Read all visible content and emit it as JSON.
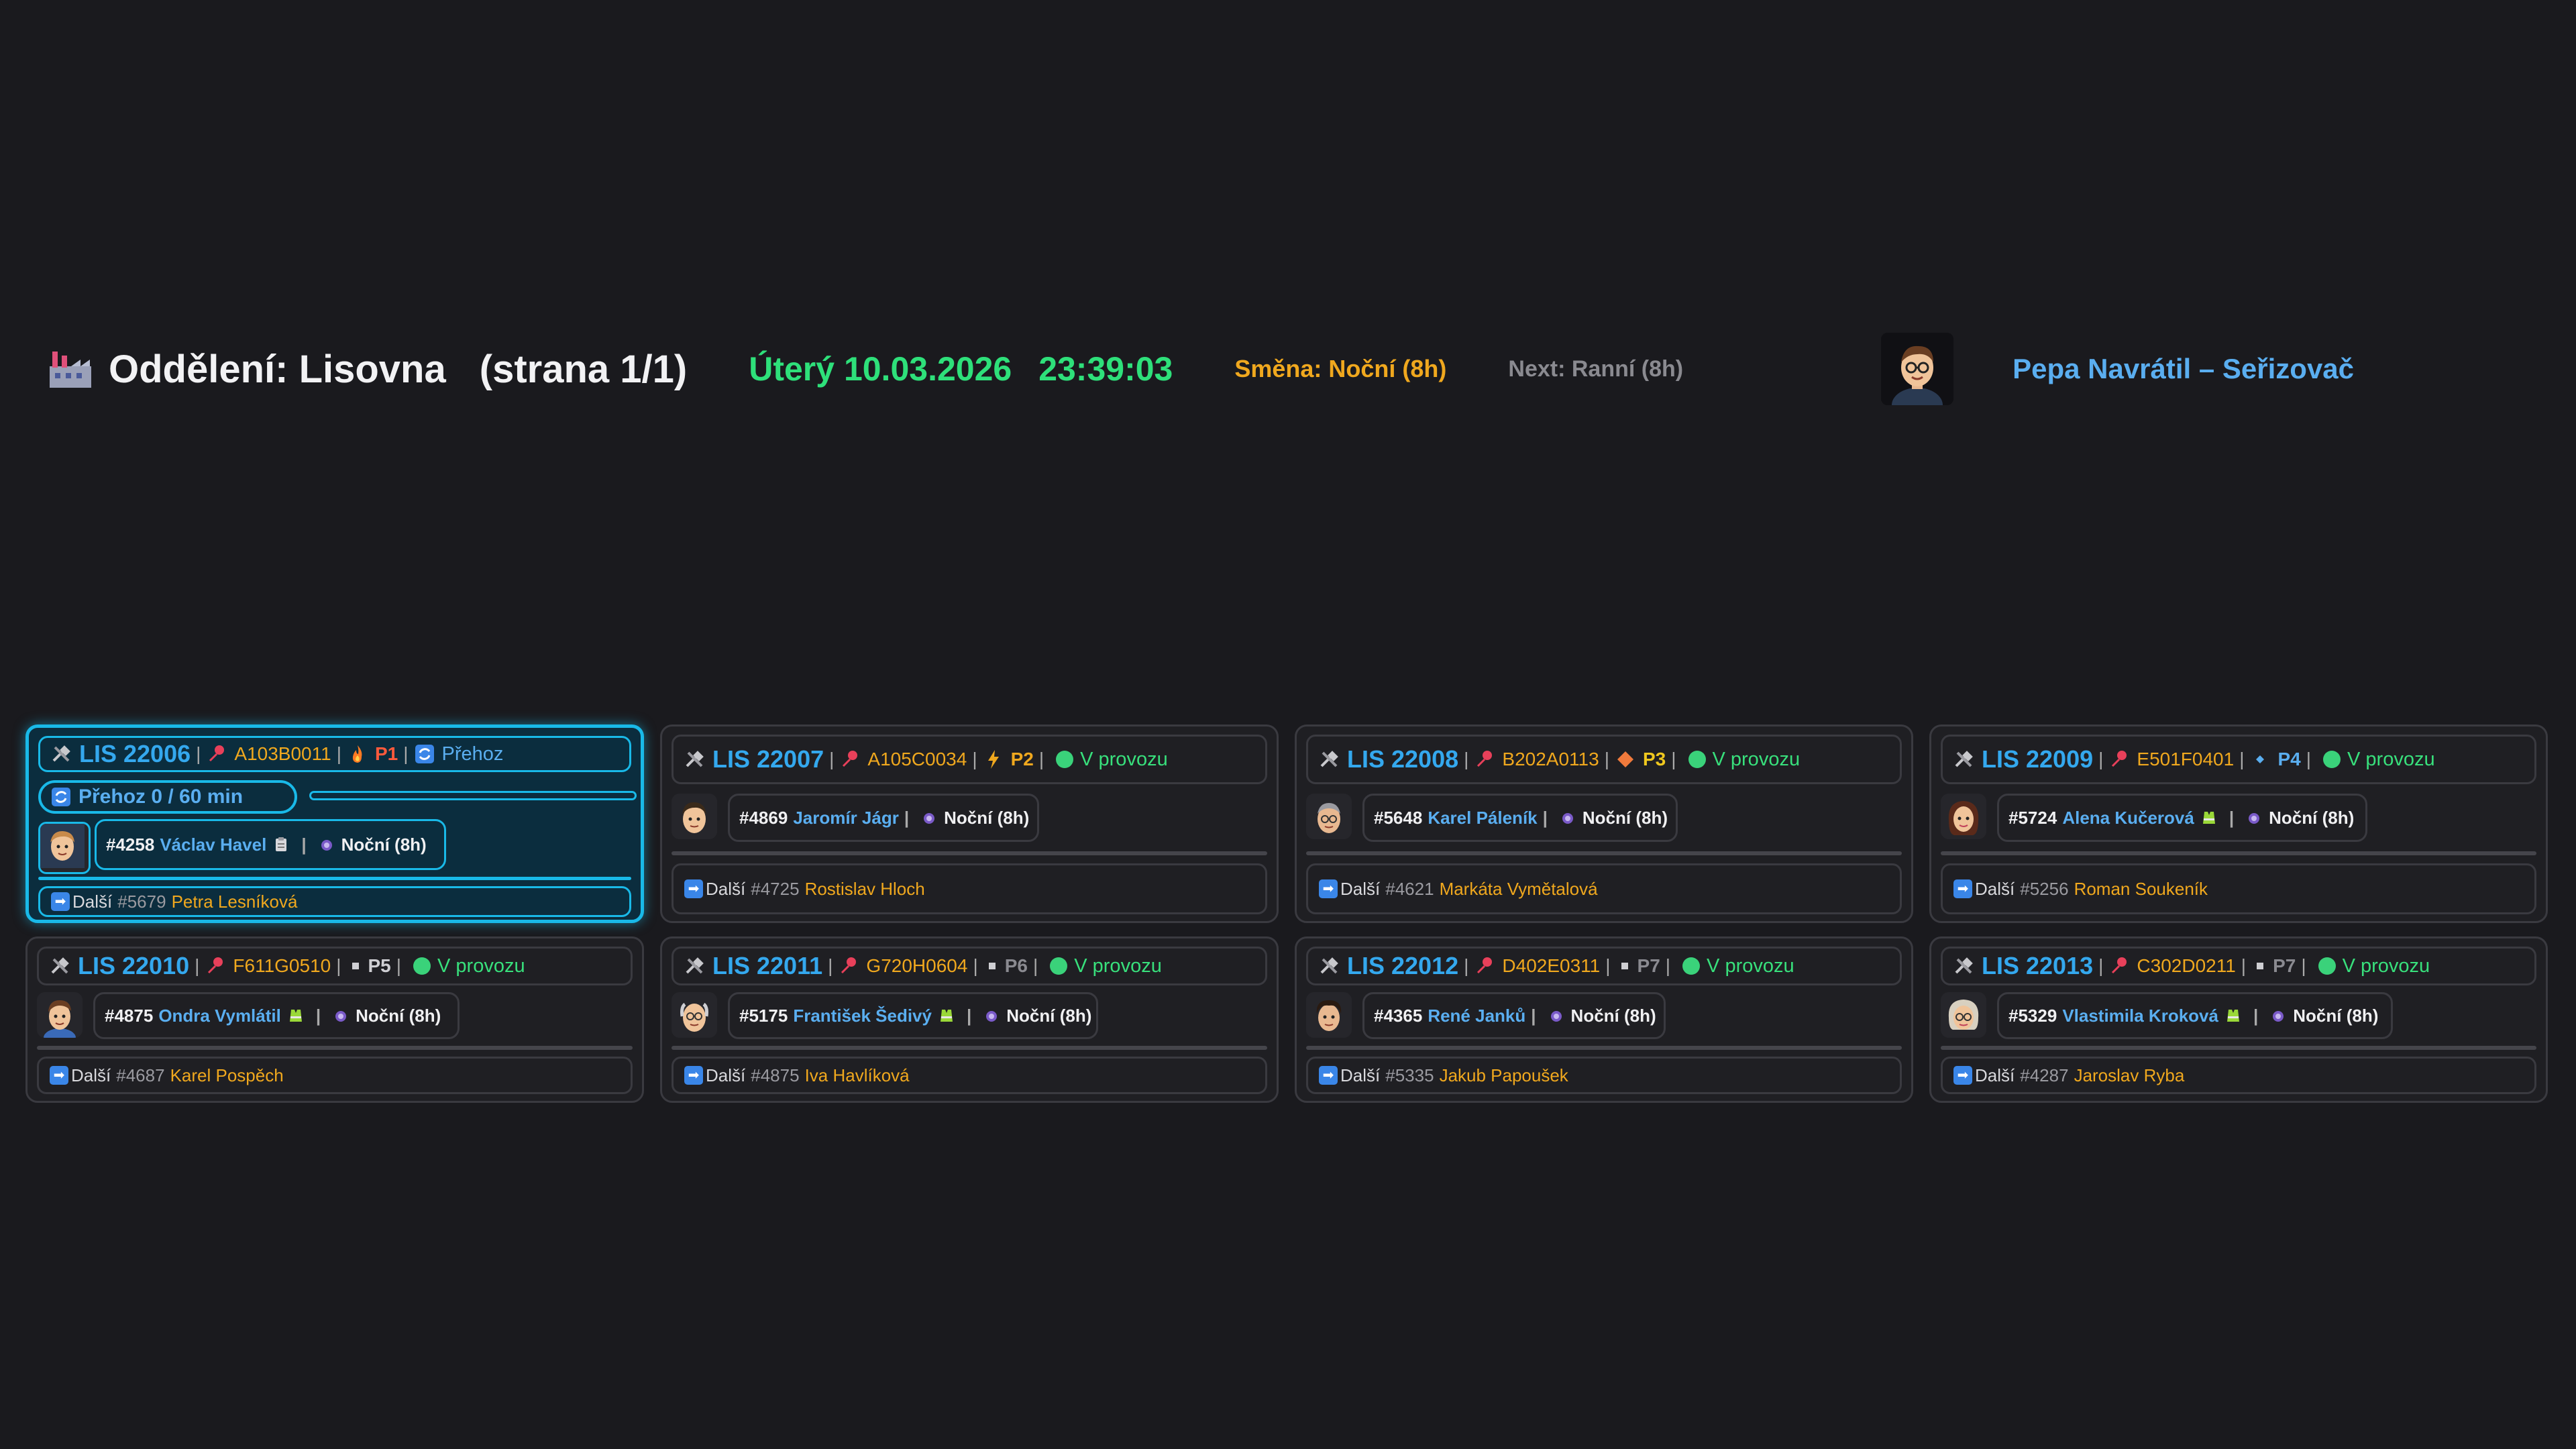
{
  "header": {
    "department": "Oddělení: Lisovna",
    "page": "(strana 1/1)",
    "date": "Úterý 10.03.2026",
    "time": "23:39:03",
    "shift": "Směna: Noční (8h)",
    "next_shift": "Next: Ranní (8h)",
    "user": "Pepa Navrátil – Seřizovač"
  },
  "machines": [
    {
      "id": "LIS 22006",
      "part": "A103B0011",
      "priority": "P1",
      "priority_icon": "fire-icon",
      "priority_color": "#ff5a3c",
      "status": "Přehoz",
      "status_type": "changeover",
      "changeover": {
        "label": "Přehoz 0 / 60 min",
        "progress": 0
      },
      "operator": {
        "number": "#4258",
        "name": "Václav Havel",
        "shift": "Noční (8h)"
      },
      "next": {
        "label": "Další",
        "number": "#5679",
        "name": "Petra Lesníková"
      }
    },
    {
      "id": "LIS 22007",
      "part": "A105C0034",
      "priority": "P2",
      "priority_icon": "lightning-icon",
      "priority_color": "#f0a81e",
      "status": "V provozu",
      "status_type": "running",
      "operator": {
        "number": "#4869",
        "name": "Jaromír Jágr",
        "shift": "Noční (8h)"
      },
      "next": {
        "label": "Další",
        "number": "#4725",
        "name": "Rostislav Hloch"
      }
    },
    {
      "id": "LIS 22008",
      "part": "B202A0113",
      "priority": "P3",
      "priority_icon": "diamond-icon",
      "priority_color": "#f0c81e",
      "status": "V provozu",
      "status_type": "running",
      "operator": {
        "number": "#5648",
        "name": "Karel Páleník",
        "shift": "Noční (8h)"
      },
      "next": {
        "label": "Další",
        "number": "#4621",
        "name": "Markáta Vymětalová"
      }
    },
    {
      "id": "LIS 22009",
      "part": "E501F0401",
      "priority": "P4",
      "priority_icon": "small-diamond-icon",
      "priority_color": "#5aaef0",
      "status": "V provozu",
      "status_type": "running",
      "operator": {
        "number": "#5724",
        "name": "Alena Kučerová",
        "shift": "Noční (8h)"
      },
      "next": {
        "label": "Další",
        "number": "#5256",
        "name": "Roman Soukeník"
      }
    },
    {
      "id": "LIS 22010",
      "part": "F611G0510",
      "priority": "P5",
      "priority_icon": "square-icon",
      "priority_color": "#cfcfd3",
      "status": "V provozu",
      "status_type": "running",
      "operator": {
        "number": "#4875",
        "name": "Ondra Vymlátil",
        "shift": "Noční (8h)"
      },
      "next": {
        "label": "Další",
        "number": "#4687",
        "name": "Karel Pospěch"
      }
    },
    {
      "id": "LIS 22011",
      "part": "G720H0604",
      "priority": "P6",
      "priority_icon": "square-icon",
      "priority_color": "#8a8a90",
      "status": "V provozu",
      "status_type": "running",
      "operator": {
        "number": "#5175",
        "name": "František Šedivý",
        "shift": "Noční (8h)"
      },
      "next": {
        "label": "Další",
        "number": "#4875",
        "name": "Iva Havlíková"
      }
    },
    {
      "id": "LIS 22012",
      "part": "D402E0311",
      "priority": "P7",
      "priority_icon": "square-icon",
      "priority_color": "#8a8a90",
      "status": "V provozu",
      "status_type": "running",
      "operator": {
        "number": "#4365",
        "name": "René Janků",
        "shift": "Noční (8h)"
      },
      "next": {
        "label": "Další",
        "number": "#5335",
        "name": "Jakub Papoušek"
      }
    },
    {
      "id": "LIS 22013",
      "part": "C302D0211",
      "priority": "P7",
      "priority_icon": "square-icon",
      "priority_color": "#8a8a90",
      "status": "V provozu",
      "status_type": "running",
      "operator": {
        "number": "#5329",
        "name": "Vlastimila Kroková",
        "shift": "Noční (8h)"
      },
      "next": {
        "label": "Další",
        "number": "#4287",
        "name": "Jaroslav Ryba"
      }
    }
  ]
}
